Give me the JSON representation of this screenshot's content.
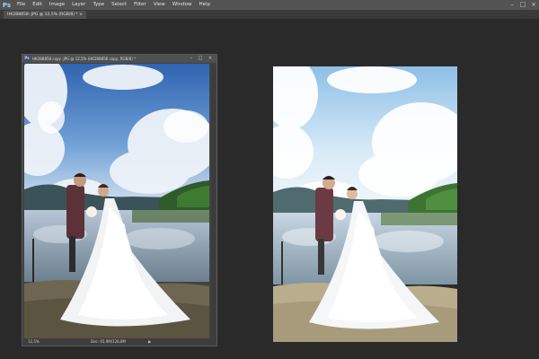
{
  "menubar": {
    "logo": "Ps",
    "items": [
      "File",
      "Edit",
      "Image",
      "Layer",
      "Type",
      "Select",
      "Filter",
      "View",
      "Window",
      "Help"
    ],
    "window_controls": [
      "–",
      "□",
      "×"
    ]
  },
  "tab": {
    "label": "HK2B8858-.JPG @ 12,5% (RGB/8) * ×"
  },
  "floating_window": {
    "title": "HK2B8858 copy .JPG @ 12,5% (HK2B8858 copy, RGB/8) *",
    "controls": [
      "–",
      "□",
      "×"
    ],
    "zoom": "12,5%",
    "doc_info": "Doc: 65,9M/126,8M",
    "arrow": "▶"
  },
  "colors": {
    "sky_top": "#3f72b9",
    "sky_bottom": "#cfe0f2",
    "sky_bright_top": "#8fbfe6",
    "gown": "#f3f4f6",
    "suit": "#5b3238"
  }
}
